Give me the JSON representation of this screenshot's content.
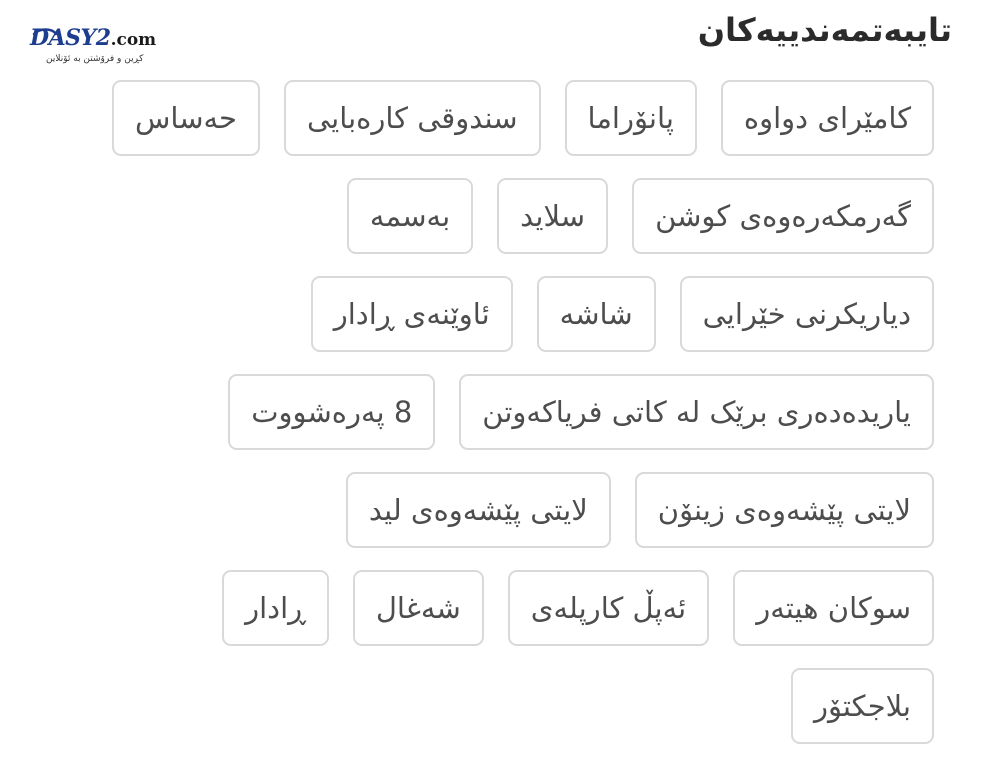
{
  "logo": {
    "name": "DASY2",
    "suffix": ".com",
    "tagline": "کڕین و فرۆشتن بە ئۆنلاین",
    "color": "#1d3d8f"
  },
  "section_title": "تایبەتمەندییەکان",
  "features": [
    [
      "کامێرای دواوە",
      "پانۆراما",
      "سندوقی کارەبایی",
      "حەساس"
    ],
    [
      "گەرمکەرەوەی کوشن",
      "سلاید",
      "بەسمە"
    ],
    [
      "دیاریکرنی خێرایی",
      "شاشە",
      "ئاوێنەی ڕادار"
    ],
    [
      "یاریدەدەری برێک لە کاتی فریاکەوتن",
      "8 پەرەشووت"
    ],
    [
      "لایتی پێشەوەی زینۆن",
      "لایتی پێشەوەی لید"
    ],
    [
      "سوکان هیتەر",
      "ئەپڵ کارپلەی",
      "شەغال",
      "ڕادار"
    ],
    [
      "بلاجکتۆر"
    ]
  ]
}
